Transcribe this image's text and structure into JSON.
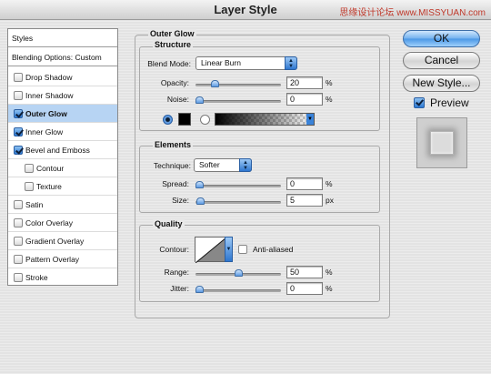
{
  "window": {
    "title": "Layer Style",
    "watermark": "思缘设计论坛 www.MISSYUAN.com"
  },
  "styles_list": {
    "header": "Styles",
    "blending_options": "Blending Options: Custom",
    "items": [
      {
        "label": "Drop Shadow",
        "checked": false
      },
      {
        "label": "Inner Shadow",
        "checked": false
      },
      {
        "label": "Outer Glow",
        "checked": true
      },
      {
        "label": "Inner Glow",
        "checked": true
      },
      {
        "label": "Bevel and Emboss",
        "checked": true
      },
      {
        "label": "Contour",
        "checked": false
      },
      {
        "label": "Texture",
        "checked": false
      },
      {
        "label": "Satin",
        "checked": false
      },
      {
        "label": "Color Overlay",
        "checked": false
      },
      {
        "label": "Gradient Overlay",
        "checked": false
      },
      {
        "label": "Pattern Overlay",
        "checked": false
      },
      {
        "label": "Stroke",
        "checked": false
      }
    ],
    "selected": "Outer Glow"
  },
  "outer_glow": {
    "title": "Outer Glow",
    "structure": {
      "title": "Structure",
      "blend_mode_label": "Blend Mode:",
      "blend_mode_value": "Linear Burn",
      "opacity_label": "Opacity:",
      "opacity_value": "20",
      "opacity_unit": "%",
      "noise_label": "Noise:",
      "noise_value": "0",
      "noise_unit": "%",
      "color_mode": "solid",
      "glow_color": "#000000"
    },
    "elements": {
      "title": "Elements",
      "technique_label": "Technique:",
      "technique_value": "Softer",
      "spread_label": "Spread:",
      "spread_value": "0",
      "spread_unit": "%",
      "size_label": "Size:",
      "size_value": "5",
      "size_unit": "px"
    },
    "quality": {
      "title": "Quality",
      "contour_label": "Contour:",
      "anti_aliased_label": "Anti-aliased",
      "anti_aliased": false,
      "range_label": "Range:",
      "range_value": "50",
      "range_unit": "%",
      "jitter_label": "Jitter:",
      "jitter_value": "0",
      "jitter_unit": "%"
    }
  },
  "buttons": {
    "ok": "OK",
    "cancel": "Cancel",
    "new_style": "New Style...",
    "preview_label": "Preview",
    "preview_checked": true
  },
  "colors": {
    "accent": "#4a97e6",
    "selection": "#b7d4f3"
  }
}
